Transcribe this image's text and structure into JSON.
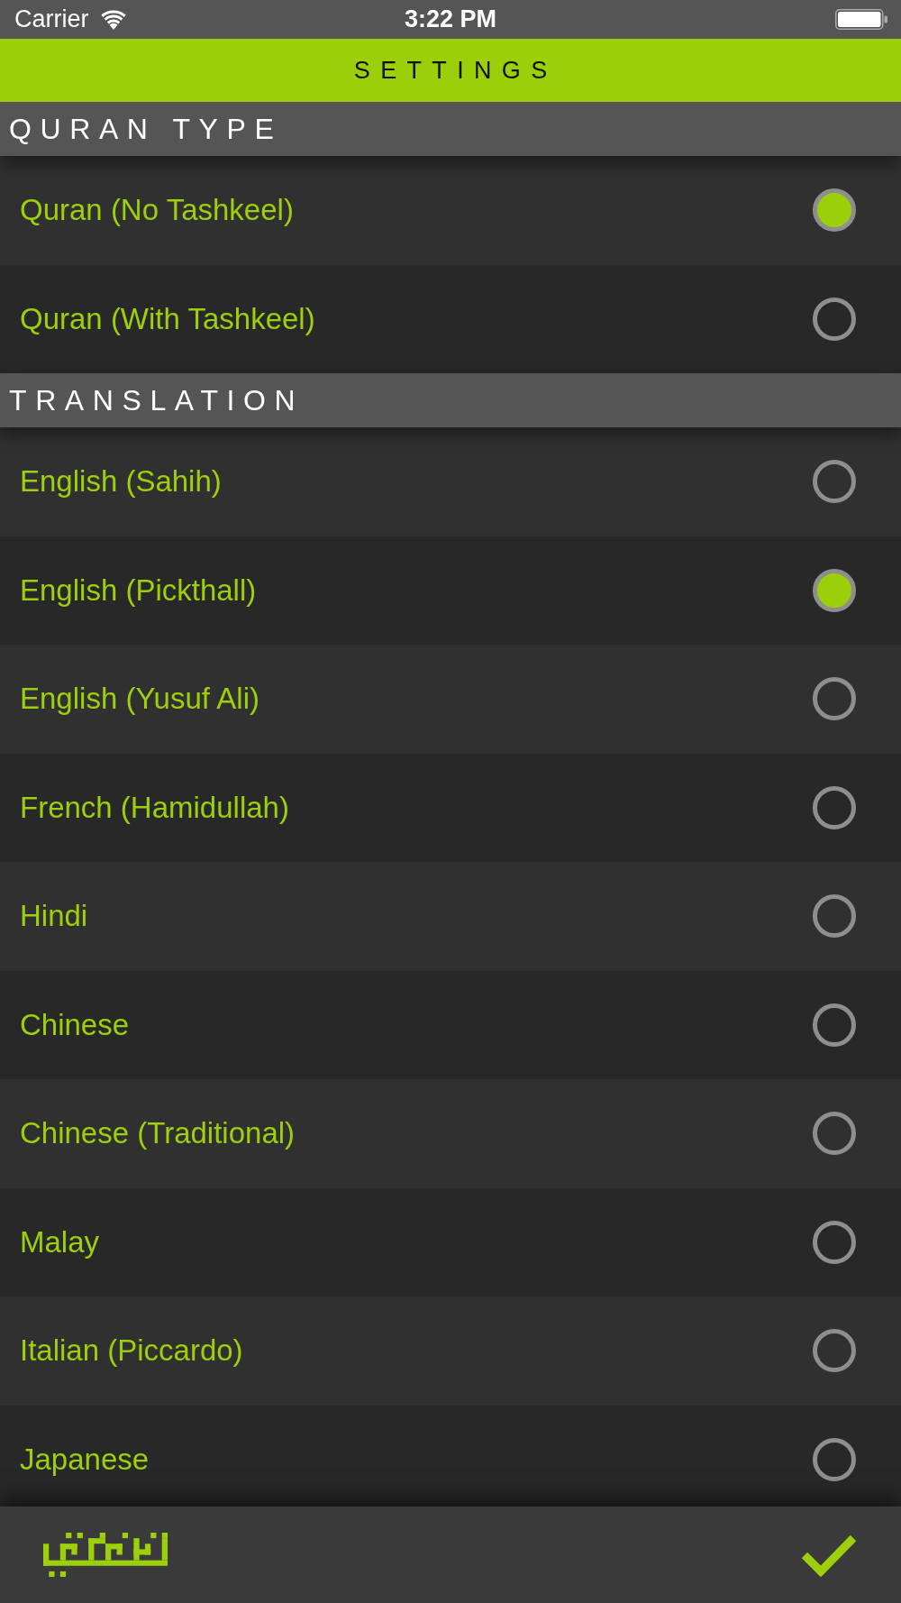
{
  "status_bar": {
    "carrier": "Carrier",
    "time": "3:22 PM"
  },
  "header": {
    "title": "SETTINGS"
  },
  "sections": [
    {
      "title": "QURAN TYPE",
      "options": [
        {
          "label": "Quran (No Tashkeel)",
          "selected": true
        },
        {
          "label": "Quran (With Tashkeel)",
          "selected": false
        }
      ]
    },
    {
      "title": "TRANSLATION",
      "options": [
        {
          "label": "English (Sahih)",
          "selected": false
        },
        {
          "label": "English (Pickthall)",
          "selected": true
        },
        {
          "label": "English (Yusuf Ali)",
          "selected": false
        },
        {
          "label": "French (Hamidullah)",
          "selected": false
        },
        {
          "label": "Hindi",
          "selected": false
        },
        {
          "label": "Chinese",
          "selected": false
        },
        {
          "label": "Chinese (Traditional)",
          "selected": false
        },
        {
          "label": "Malay",
          "selected": false
        },
        {
          "label": "Italian (Piccardo)",
          "selected": false
        },
        {
          "label": "Japanese",
          "selected": false
        }
      ]
    }
  ]
}
